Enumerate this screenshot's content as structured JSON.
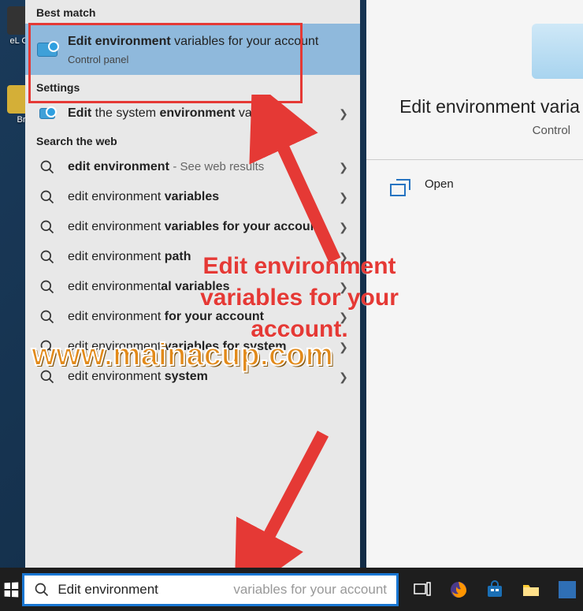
{
  "desktop": {
    "icons": [
      {
        "label": "eL\nCo"
      },
      {
        "label": "Br"
      }
    ]
  },
  "search": {
    "sections": {
      "best_match": "Best match",
      "settings": "Settings",
      "web": "Search the web"
    },
    "best": {
      "title_html": "<b>Edit environment</b> variables for your account",
      "subtitle": "Control panel"
    },
    "settings_items": [
      {
        "title_html": "<b>Edit</b> the system <b>environment</b> variables"
      }
    ],
    "web_items": [
      {
        "title_html": "<b>edit environment</b> <span style='color:#666;font-size:15px'>- See web results</span>"
      },
      {
        "title_html": "edit environment <b>variables</b>"
      },
      {
        "title_html": "edit environment <b>variables for your account</b>"
      },
      {
        "title_html": "edit environment <b>path</b>"
      },
      {
        "title_html": "edit environment<b>al variables</b>"
      },
      {
        "title_html": "edit environment <b>for your account</b>"
      },
      {
        "title_html": "edit environment <b>variables for system</b>"
      },
      {
        "title_html": "edit environment <b>system</b>"
      }
    ]
  },
  "detail": {
    "title": "Edit environment varia",
    "subtitle": "Control",
    "open": "Open"
  },
  "taskbar": {
    "search_value": "Edit environment ",
    "search_placeholder": "variables for your account"
  },
  "annotations": {
    "line1": "Edit environment",
    "line2": "variables for your account.",
    "watermark": "www.mainacup.com"
  },
  "colors": {
    "highlight": "#e53935",
    "accent": "#8fb9dc",
    "searchbox_border": "#1976d2"
  }
}
